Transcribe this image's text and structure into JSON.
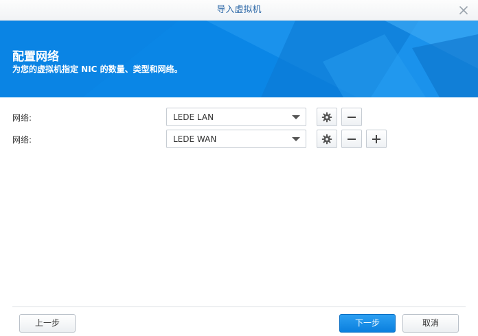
{
  "window": {
    "title": "导入虚拟机",
    "close_icon": "close-icon"
  },
  "banner": {
    "title": "配置网络",
    "subtitle": "为您的虚拟机指定 NIC 的数量、类型和网络。",
    "color": "#0a86e6"
  },
  "networks": [
    {
      "label": "网络:",
      "value": "LEDE LAN",
      "actions": [
        "gear-icon",
        "minus-icon"
      ]
    },
    {
      "label": "网络:",
      "value": "LEDE WAN",
      "actions": [
        "gear-icon",
        "minus-icon",
        "plus-icon"
      ]
    }
  ],
  "footer": {
    "prev_label": "上一步",
    "next_label": "下一步",
    "cancel_label": "取消",
    "primary_color": "#0a7fde"
  }
}
